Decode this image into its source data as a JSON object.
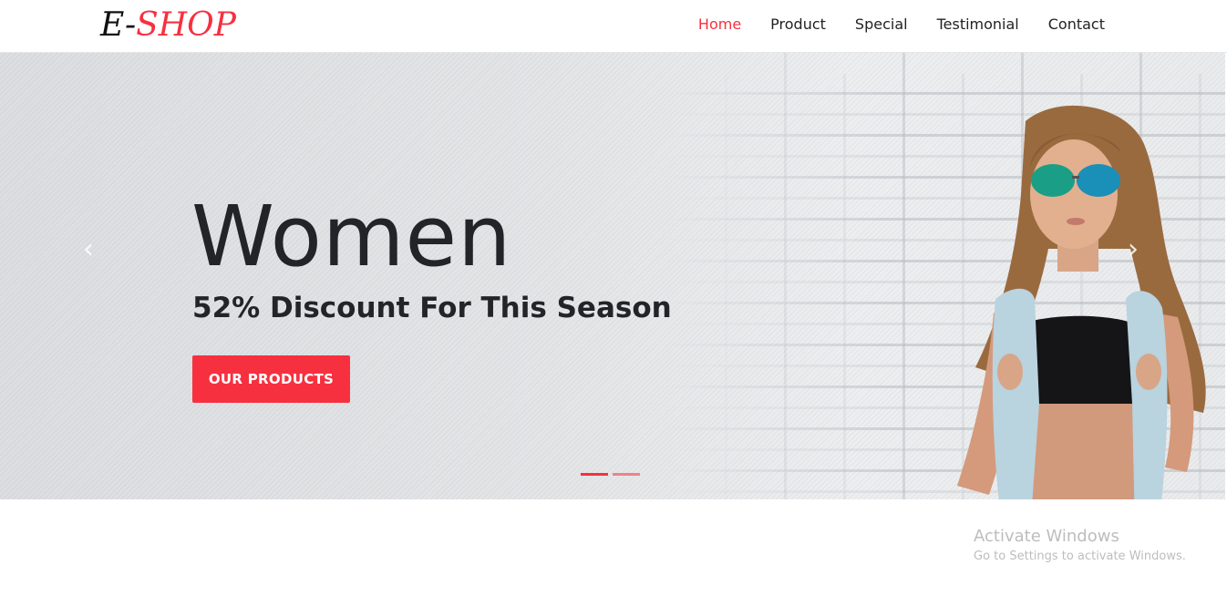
{
  "brand": {
    "prefix": "E-",
    "accent": "SHOP"
  },
  "nav": {
    "items": [
      {
        "label": "Home",
        "active": true
      },
      {
        "label": "Product",
        "active": false
      },
      {
        "label": "Special",
        "active": false
      },
      {
        "label": "Testimonial",
        "active": false
      },
      {
        "label": "Contact",
        "active": false
      }
    ]
  },
  "hero": {
    "title": "Women",
    "subtitle": "52% Discount For This Season",
    "cta_label": "OUR PRODUCTS",
    "prev_icon": "chevron-left-icon",
    "next_icon": "chevron-right-icon",
    "slides_count": 2,
    "active_slide": 1
  },
  "watermark": {
    "title": "Activate Windows",
    "subtitle": "Go to Settings to activate Windows."
  },
  "colors": {
    "accent": "#f7303f",
    "text": "#222428",
    "nav_text": "#222222"
  }
}
